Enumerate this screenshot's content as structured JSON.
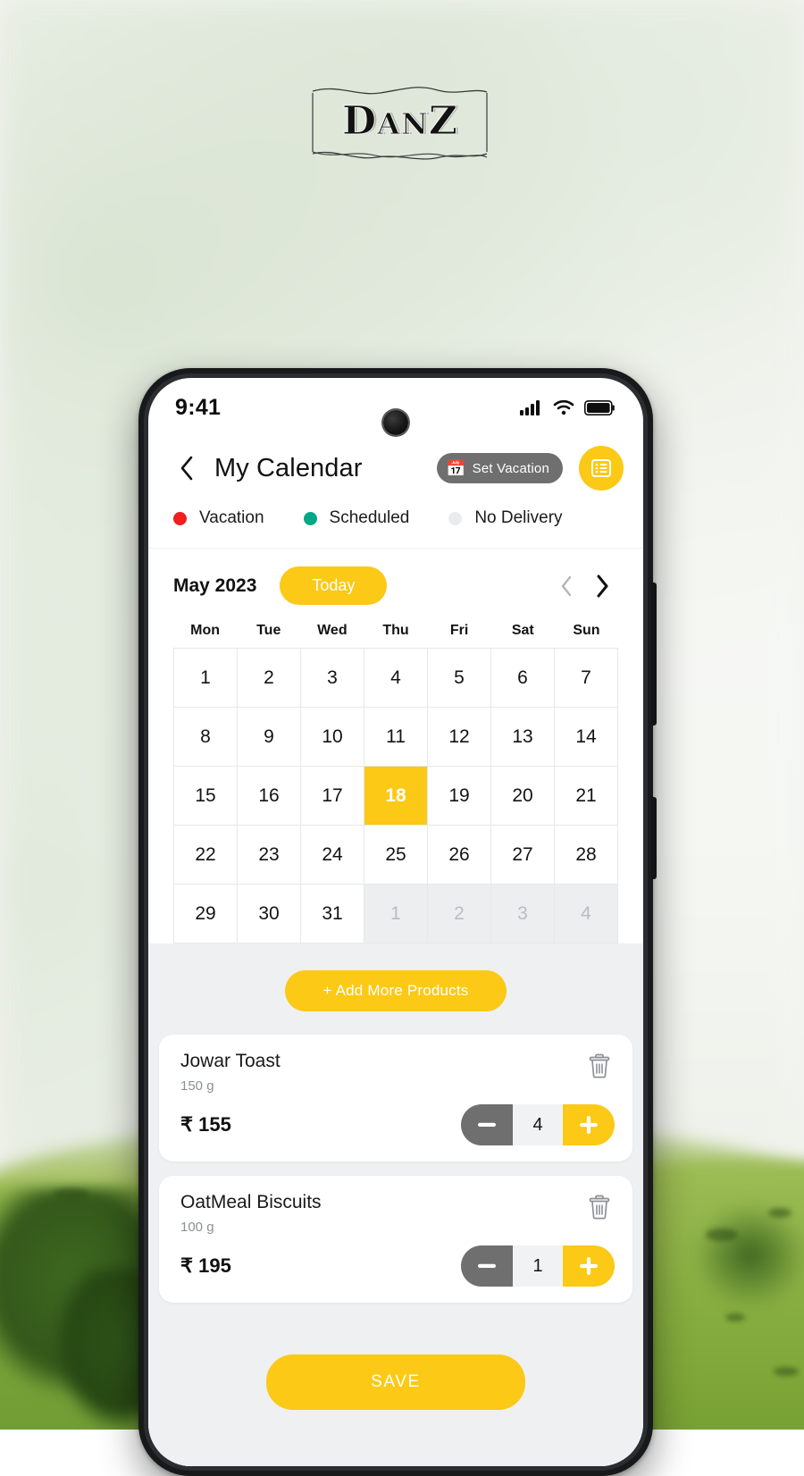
{
  "brand": {
    "logo_text_d": "D",
    "logo_text_an": "AN",
    "logo_text_z": "Z",
    "logo_full": "DANZ",
    "accent_yellow": "#FBC916",
    "gray_pill": "#6F6F6F",
    "pane_bg": "#EFF0F2"
  },
  "status_bar": {
    "time": "9:41",
    "signal_icon": "signal-bars-icon",
    "wifi_icon": "wifi-icon",
    "battery_icon": "battery-full-icon"
  },
  "header": {
    "back_icon": "chevron-left-icon",
    "title": "My Calendar",
    "vacation_button": {
      "label": "Set Vacation",
      "icon": "calendar-emoji-icon"
    },
    "list_button_icon": "list-icon"
  },
  "legend": [
    {
      "label": "Vacation",
      "color": "#F01E1E",
      "dot": "red-dot-icon"
    },
    {
      "label": "Scheduled",
      "color": "#00A887",
      "dot": "teal-dot-icon"
    },
    {
      "label": "No  Delivery",
      "color": "#E9EBED",
      "dot": "gray-dot-icon"
    }
  ],
  "calendar": {
    "month_label": "May 2023",
    "today_button_label": "Today",
    "prev_icon": "chevron-left-icon",
    "next_icon": "chevron-right-icon",
    "weekdays": [
      "Mon",
      "Tue",
      "Wed",
      "Thu",
      "Fri",
      "Sat",
      "Sun"
    ],
    "selected_day": 18,
    "cells": [
      {
        "n": "1",
        "muted": false
      },
      {
        "n": "2",
        "muted": false
      },
      {
        "n": "3",
        "muted": false
      },
      {
        "n": "4",
        "muted": false
      },
      {
        "n": "5",
        "muted": false
      },
      {
        "n": "6",
        "muted": false
      },
      {
        "n": "7",
        "muted": false
      },
      {
        "n": "8",
        "muted": false
      },
      {
        "n": "9",
        "muted": false
      },
      {
        "n": "10",
        "muted": false
      },
      {
        "n": "11",
        "muted": false
      },
      {
        "n": "12",
        "muted": false
      },
      {
        "n": "13",
        "muted": false
      },
      {
        "n": "14",
        "muted": false
      },
      {
        "n": "15",
        "muted": false
      },
      {
        "n": "16",
        "muted": false
      },
      {
        "n": "17",
        "muted": false
      },
      {
        "n": "18",
        "muted": false,
        "today": true
      },
      {
        "n": "19",
        "muted": false
      },
      {
        "n": "20",
        "muted": false
      },
      {
        "n": "21",
        "muted": false
      },
      {
        "n": "22",
        "muted": false
      },
      {
        "n": "23",
        "muted": false
      },
      {
        "n": "24",
        "muted": false
      },
      {
        "n": "25",
        "muted": false
      },
      {
        "n": "26",
        "muted": false
      },
      {
        "n": "27",
        "muted": false
      },
      {
        "n": "28",
        "muted": false
      },
      {
        "n": "29",
        "muted": false
      },
      {
        "n": "30",
        "muted": false
      },
      {
        "n": "31",
        "muted": false
      },
      {
        "n": "1",
        "muted": true
      },
      {
        "n": "2",
        "muted": true
      },
      {
        "n": "3",
        "muted": true
      },
      {
        "n": "4",
        "muted": true
      }
    ]
  },
  "products_section": {
    "add_button_label": "+ Add More Products",
    "items": [
      {
        "name": "Jowar Toast",
        "weight": "150 g",
        "price": "₹ 155",
        "qty": "4",
        "delete_icon": "trash-icon",
        "minus_icon": "minus-icon",
        "plus_icon": "plus-icon"
      },
      {
        "name": "OatMeal Biscuits",
        "weight": "100 g",
        "price": "₹ 195",
        "qty": "1",
        "delete_icon": "trash-icon",
        "minus_icon": "minus-icon",
        "plus_icon": "plus-icon"
      }
    ],
    "save_button_label": "SAVE"
  }
}
